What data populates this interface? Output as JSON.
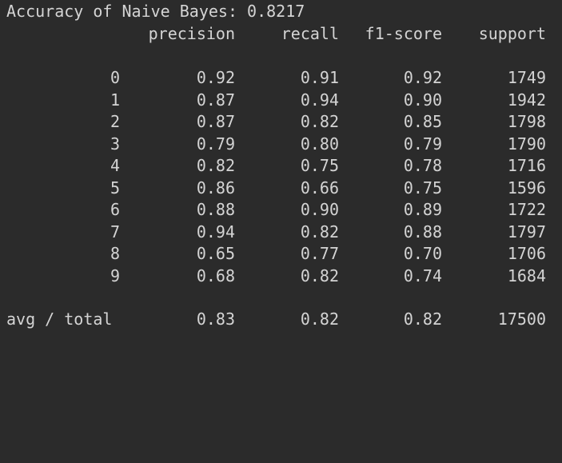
{
  "accuracy_line": "Accuracy of Naive Bayes: 0.8217",
  "headers": {
    "precision": "precision",
    "recall": "recall",
    "f1": "f1-score",
    "support": "support"
  },
  "rows": [
    {
      "label": "0",
      "precision": "0.92",
      "recall": "0.91",
      "f1": "0.92",
      "support": "1749"
    },
    {
      "label": "1",
      "precision": "0.87",
      "recall": "0.94",
      "f1": "0.90",
      "support": "1942"
    },
    {
      "label": "2",
      "precision": "0.87",
      "recall": "0.82",
      "f1": "0.85",
      "support": "1798"
    },
    {
      "label": "3",
      "precision": "0.79",
      "recall": "0.80",
      "f1": "0.79",
      "support": "1790"
    },
    {
      "label": "4",
      "precision": "0.82",
      "recall": "0.75",
      "f1": "0.78",
      "support": "1716"
    },
    {
      "label": "5",
      "precision": "0.86",
      "recall": "0.66",
      "f1": "0.75",
      "support": "1596"
    },
    {
      "label": "6",
      "precision": "0.88",
      "recall": "0.90",
      "f1": "0.89",
      "support": "1722"
    },
    {
      "label": "7",
      "precision": "0.94",
      "recall": "0.82",
      "f1": "0.88",
      "support": "1797"
    },
    {
      "label": "8",
      "precision": "0.65",
      "recall": "0.77",
      "f1": "0.70",
      "support": "1706"
    },
    {
      "label": "9",
      "precision": "0.68",
      "recall": "0.82",
      "f1": "0.74",
      "support": "1684"
    }
  ],
  "total": {
    "label": "avg / total",
    "precision": "0.83",
    "recall": "0.82",
    "f1": "0.82",
    "support": "17500"
  }
}
